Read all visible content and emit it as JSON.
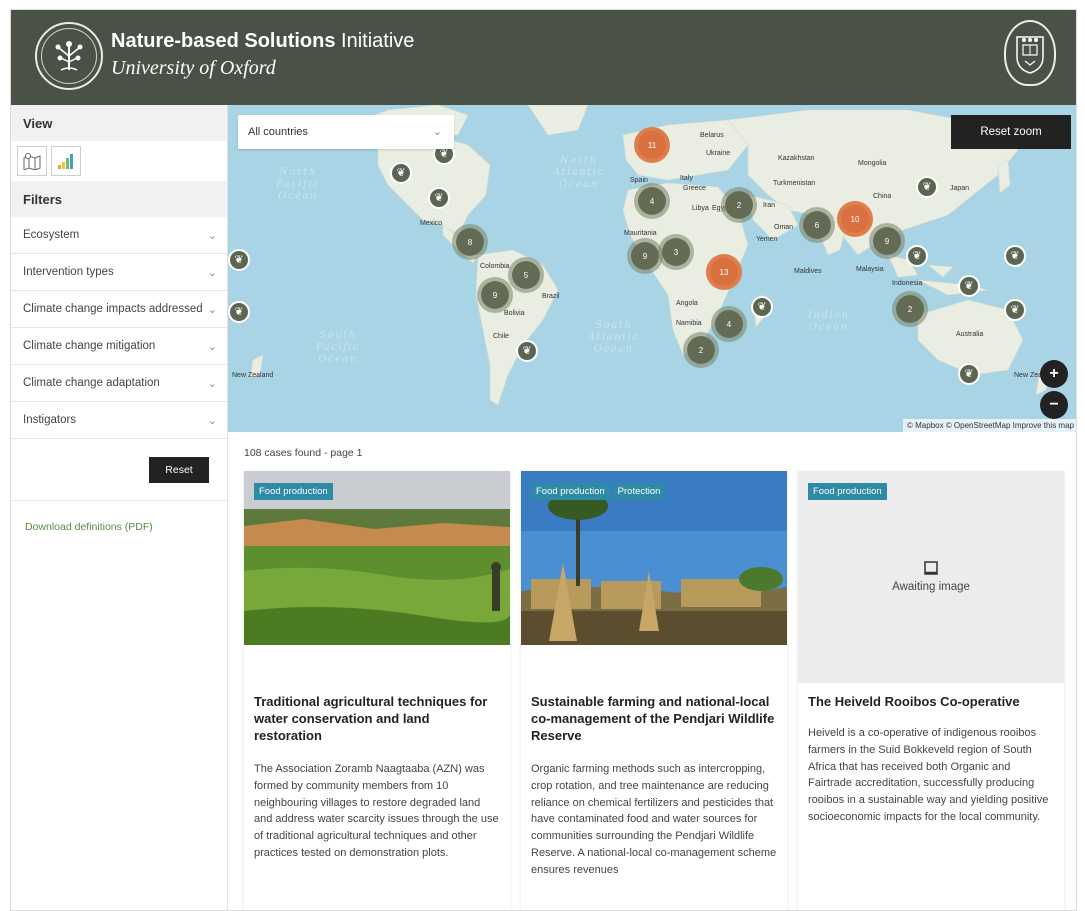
{
  "header": {
    "title_bold": "Nature-based Solutions",
    "title_rest": "Initiative",
    "subtitle": "University of Oxford"
  },
  "sidebar": {
    "view_label": "View",
    "filters_label": "Filters",
    "filters": [
      {
        "label": "Ecosystem"
      },
      {
        "label": "Intervention types"
      },
      {
        "label": "Climate change impacts addressed"
      },
      {
        "label": "Climate change mitigation"
      },
      {
        "label": "Climate change adaptation"
      },
      {
        "label": "Instigators"
      }
    ],
    "reset_label": "Reset",
    "download_label": "Download definitions (PDF)"
  },
  "map": {
    "country_select_value": "All countries",
    "reset_zoom_label": "Reset zoom",
    "zoom_in": "+",
    "zoom_out": "−",
    "attribution": "© Mapbox © OpenStreetMap Improve this map",
    "oceans": [
      "North Pacific Ocean",
      "North Atlantic Ocean",
      "South Pacific Ocean",
      "South Atlantic Ocean",
      "Indian Ocean"
    ],
    "places": [
      "Belarus",
      "Ukraine",
      "Kazakhstan",
      "Mongolia",
      "Spain",
      "Italy",
      "Greece",
      "Turkmenistan",
      "China",
      "Japan",
      "Libya",
      "Egypt",
      "Iran",
      "Oman",
      "Yemen",
      "Mauritania",
      "Mexico",
      "Colombia",
      "Brazil",
      "Bolivia",
      "Chile",
      "Angola",
      "Namibia",
      "Maldives",
      "Malaysia",
      "Indonesia",
      "Australia",
      "New Zealand"
    ],
    "clusters": [
      {
        "count": "11",
        "color": "orange"
      },
      {
        "count": "4",
        "color": "green"
      },
      {
        "count": "2",
        "color": "green"
      },
      {
        "count": "8",
        "color": "green"
      },
      {
        "count": "5",
        "color": "green"
      },
      {
        "count": "9",
        "color": "green"
      },
      {
        "count": "9",
        "color": "green"
      },
      {
        "count": "3",
        "color": "green"
      },
      {
        "count": "13",
        "color": "orange"
      },
      {
        "count": "6",
        "color": "green"
      },
      {
        "count": "10",
        "color": "orange"
      },
      {
        "count": "9",
        "color": "green"
      },
      {
        "count": "4",
        "color": "green"
      },
      {
        "count": "2",
        "color": "green"
      },
      {
        "count": "2",
        "color": "green"
      }
    ]
  },
  "results": {
    "found_text": "108 cases found - page 1",
    "cards": [
      {
        "tags": [
          "Food production"
        ],
        "title": "Traditional agricultural techniques for water conservation and land restoration",
        "body": "The Association Zoramb Naagtaaba (AZN) was formed by community members from 10 neighbouring villages to restore degraded land and address water scarcity issues through the use of traditional agricultural techniques and other practices tested on demonstration plots."
      },
      {
        "tags": [
          "Food production",
          "Protection"
        ],
        "title": "Sustainable farming and national-local co-management of the Pendjari Wildlife Reserve",
        "body": "Organic farming methods such as intercropping, crop rotation, and tree maintenance are reducing reliance on chemical fertilizers and pesticides that have contaminated food and water sources for communities surrounding the Pendjari Wildlife Reserve. A national-local co-management scheme ensures revenues"
      },
      {
        "tags": [
          "Food production"
        ],
        "image_placeholder": "Awaiting image",
        "title": "The Heiveld Rooibos Co-operative",
        "body": "Heiveld is a co-operative of indigenous rooibos farmers in the Suid Bokkeveld region of South Africa that has received both Organic and Fairtrade accreditation, successfully producing rooibos in a sustainable way and yielding positive socioeconomic impacts for the local community."
      }
    ]
  },
  "colors": {
    "header_bg": "#4a5248",
    "tag_bg": "#2f8aa5",
    "cluster_green": "#636b55",
    "cluster_orange": "#d9703f"
  }
}
